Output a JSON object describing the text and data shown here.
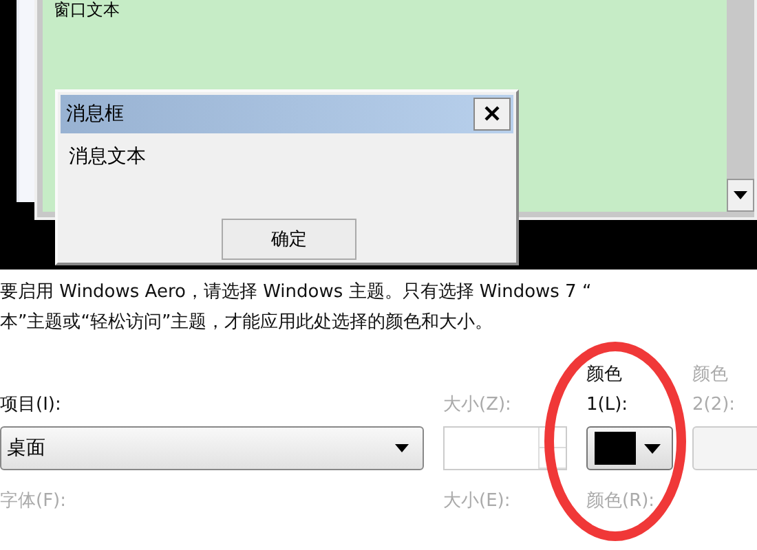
{
  "preview": {
    "window_text": "窗口文本",
    "message_box": {
      "title": "消息框",
      "text": "消息文本",
      "button": "确定"
    }
  },
  "description": [
    "要启用 Windows Aero，请选择 Windows 主题。只有选择 Windows 7 “",
    "本”主题或“轻松访问”主题，才能应用此处选择的颜色和大小。"
  ],
  "item": {
    "label": "项目(I):",
    "value": "桌面"
  },
  "size": {
    "label": "大小(Z):",
    "disabled": true
  },
  "color1": {
    "label_lines": [
      "颜色",
      "1(L):"
    ],
    "disabled": false,
    "color": "#000000"
  },
  "color2": {
    "label_lines": [
      "颜色",
      "2(2):"
    ],
    "disabled": true
  },
  "font": {
    "label": "字体(F):",
    "disabled": true
  },
  "font_size": {
    "label": "大小(E):",
    "disabled": true
  },
  "font_color": {
    "label": "颜色(R):",
    "disabled": true
  }
}
